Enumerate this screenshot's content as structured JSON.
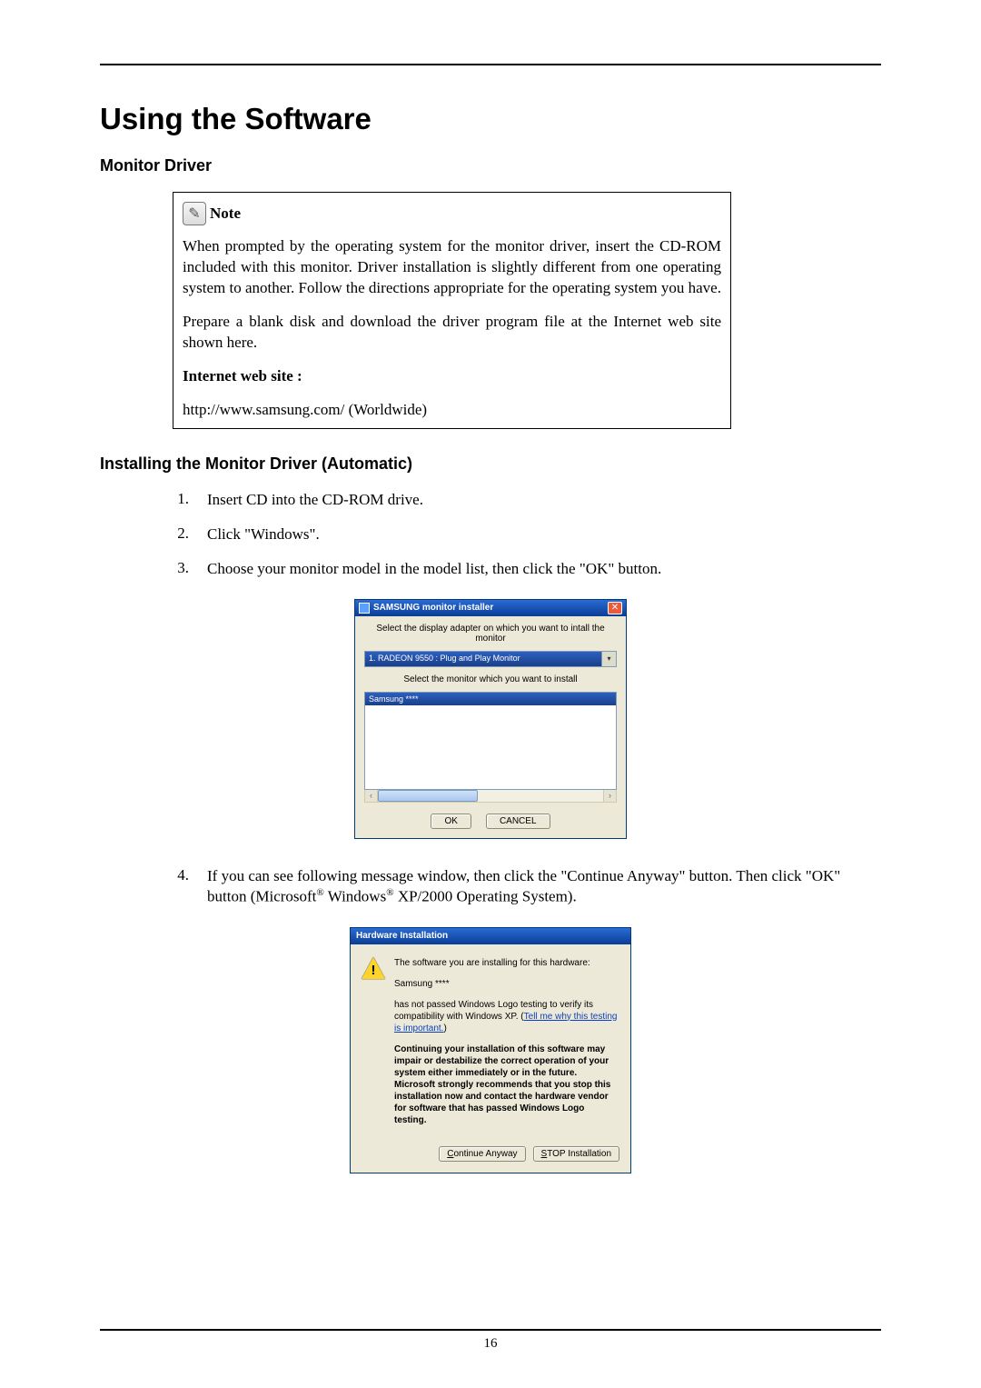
{
  "page": {
    "title": "Using the Software",
    "section1": "Monitor Driver",
    "section2": "Installing the Monitor Driver (Automatic)",
    "number": "16"
  },
  "note": {
    "icon_glyph": "✎",
    "label": "Note",
    "para1": "When prompted by the operating system for the monitor driver, insert the CD-ROM included with this monitor. Driver installation is slightly different from one operating system to another. Follow the directions appropriate for the operating system you have.",
    "para2": "Prepare a blank disk and download the driver program file at the Internet web site shown here.",
    "website_label": "Internet web site :",
    "website_url": "http://www.samsung.com/ (Worldwide)"
  },
  "steps": {
    "s1": {
      "n": "1.",
      "t": "Insert CD into the CD-ROM drive."
    },
    "s2": {
      "n": "2.",
      "t": "Click \"Windows\"."
    },
    "s3": {
      "n": "3.",
      "t": "Choose your monitor model in the model list, then click the \"OK\" button."
    },
    "s4": {
      "n": "4.",
      "t_a": "If you can see following message window, then click the \"Continue Anyway\" button. Then click \"OK\" button (Microsoft",
      "t_b": " Windows",
      "t_c": " XP/2000 Operating System).",
      "reg": "®"
    }
  },
  "dlg1": {
    "title": "SAMSUNG monitor installer",
    "close": "✕",
    "instr1": "Select the display adapter on which you want to intall the monitor",
    "dd_value": "1. RADEON 9550 : Plug and Play Monitor",
    "dd_caret": "▾",
    "instr2": "Select the monitor which you want to install",
    "list_item": "Samsung ****",
    "scroll_left": "‹",
    "scroll_right": "›",
    "ok": "OK",
    "cancel": "CANCEL"
  },
  "dlg2": {
    "title": "Hardware Installation",
    "warn": "!",
    "p1": "The software you are installing for this hardware:",
    "p2": "Samsung ****",
    "p3a": "has not passed Windows Logo testing to verify its compatibility with Windows XP. (",
    "p3_link": "Tell me why this testing is important.",
    "p3b": ")",
    "p4": "Continuing your installation of this software may impair or destabilize the correct operation of your system either immediately or in the future. Microsoft strongly recommends that you stop this installation now and contact the hardware vendor for software that has passed Windows Logo testing.",
    "btn_continue_u": "C",
    "btn_continue_rest": "ontinue Anyway",
    "btn_stop_u": "S",
    "btn_stop_rest": "TOP Installation"
  }
}
